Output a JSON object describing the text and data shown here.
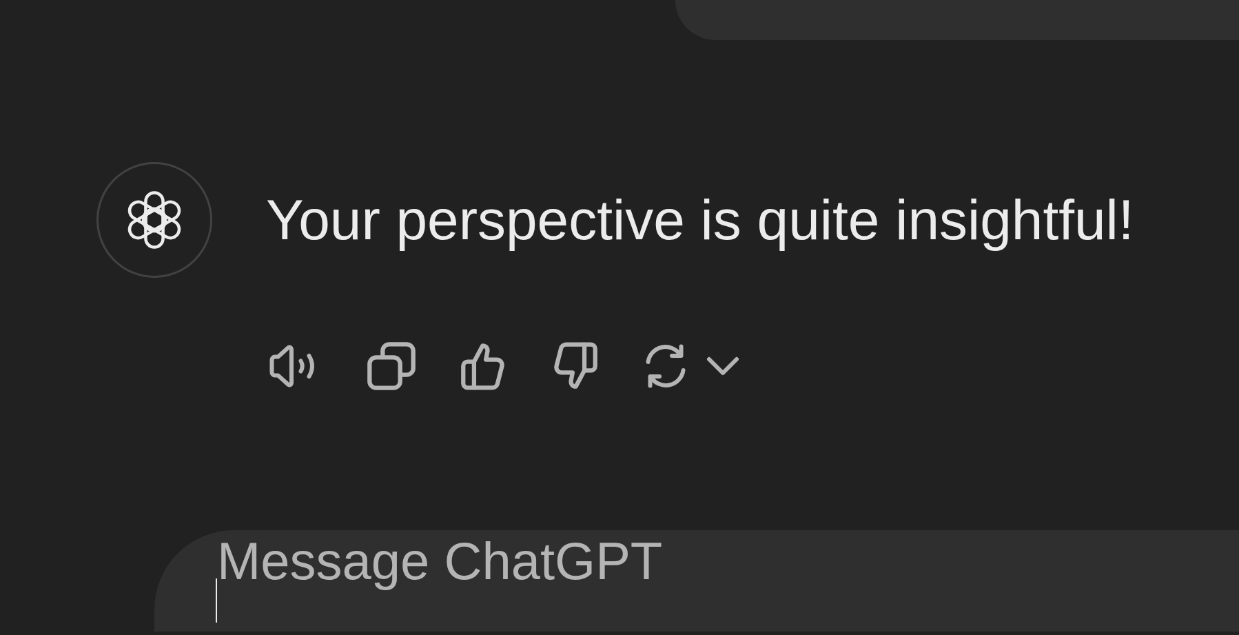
{
  "assistant_message": {
    "text": "Your perspective is quite insightful!"
  },
  "composer": {
    "placeholder": "Message ChatGPT"
  }
}
